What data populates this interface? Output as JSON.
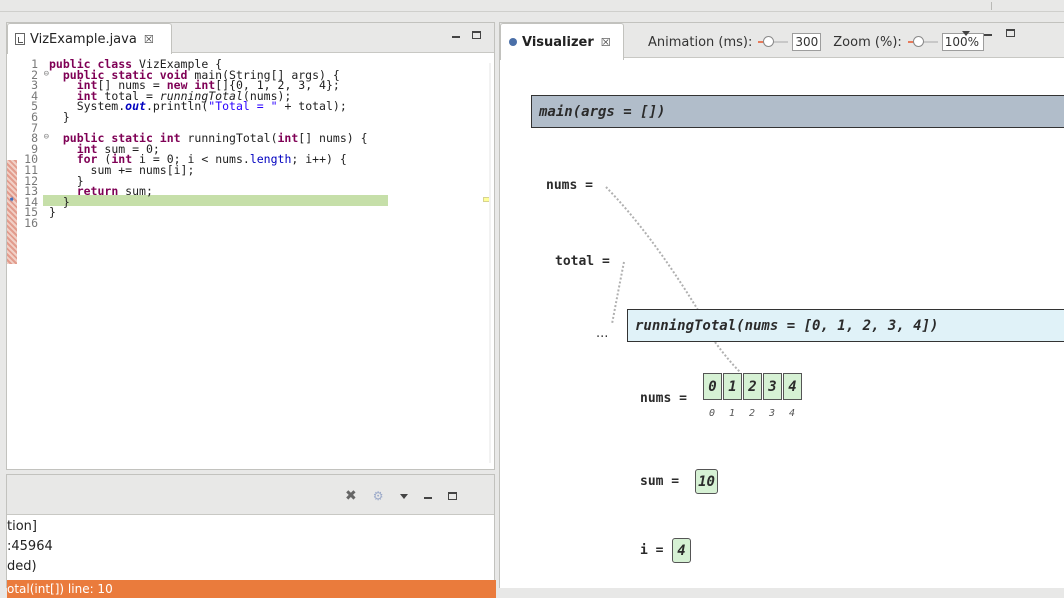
{
  "editor": {
    "tab_label": "VizExample.java",
    "tab_close": "☒",
    "lines": [
      {
        "n": "1",
        "fold": "",
        "html": "<span class=\"kw\">public class</span> VizExample {"
      },
      {
        "n": "2",
        "fold": "⊖",
        "html": "  <span class=\"kw\">public static void</span> main(String[] args) {"
      },
      {
        "n": "3",
        "fold": "",
        "html": "    <span class=\"kw\">int</span>[] nums = <span class=\"kw\">new int</span>[]{0, 1, 2, 3, 4};"
      },
      {
        "n": "4",
        "fold": "",
        "html": "    <span class=\"kw\">int</span> total = <span class=\"it\">runningTotal</span>(nums);"
      },
      {
        "n": "5",
        "fold": "",
        "html": "    System.<span class=\"fld it\" style=\"font-weight:bold\">out</span>.println(<span class=\"str\">\"Total = \"</span> + total);"
      },
      {
        "n": "6",
        "fold": "",
        "html": "  }"
      },
      {
        "n": "7",
        "fold": "",
        "html": ""
      },
      {
        "n": "8",
        "fold": "⊖",
        "html": "  <span class=\"kw\">public static int</span> runningTotal(<span class=\"kw\">int</span>[] nums) {"
      },
      {
        "n": "9",
        "fold": "",
        "html": "    <span class=\"kw\">int</span> sum = 0;"
      },
      {
        "n": "10",
        "fold": "",
        "html": "    <span class=\"kw\">for</span> (<span class=\"kw\">int</span> i = 0; i &lt; nums.<span class=\"fld\">length</span>; i++) {"
      },
      {
        "n": "11",
        "fold": "",
        "html": "      sum += nums[i];"
      },
      {
        "n": "12",
        "fold": "",
        "html": "    }"
      },
      {
        "n": "13",
        "fold": "",
        "html": "    <span class=\"kw\">return</span> sum;"
      },
      {
        "n": "14",
        "fold": "",
        "html": "  }"
      },
      {
        "n": "15",
        "fold": "",
        "html": "}"
      },
      {
        "n": "16",
        "fold": "",
        "html": ""
      }
    ]
  },
  "console": {
    "lines": [
      "tion]",
      ":45964",
      "ded)"
    ],
    "selected": "otal(int[]) line: 10"
  },
  "visualizer": {
    "tab_label": "Visualizer",
    "tab_close": "☒",
    "animation_label": "Animation (ms):",
    "animation_value": "300",
    "zoom_label": "Zoom (%):",
    "zoom_value": "100%",
    "main_frame": "main(args = [])",
    "nums_label": "nums =",
    "total_label": "total =",
    "ellipsis": "...",
    "rt_frame": "runningTotal(nums = [0, 1, 2, 3, 4])",
    "rt_nums_label": "nums =",
    "array_values": [
      "0",
      "1",
      "2",
      "3",
      "4"
    ],
    "array_indices": [
      "0",
      "1",
      "2",
      "3",
      "4"
    ],
    "sum_label": "sum =",
    "sum_value": "10",
    "i_label": "i =",
    "i_value": "4"
  },
  "icons": {
    "remove_all": "remove-all-terminated-icon",
    "gear": "debug-settings-icon"
  }
}
